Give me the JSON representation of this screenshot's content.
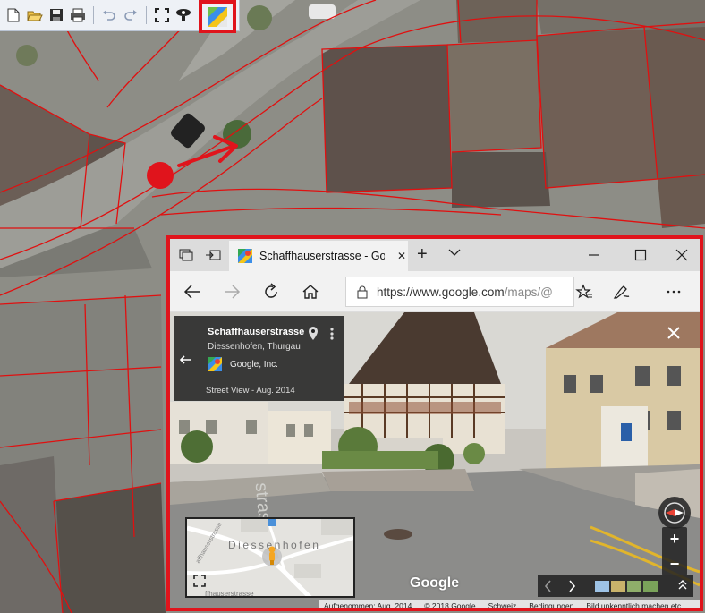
{
  "browser": {
    "tab_title": "Schaffhauserstrasse - Go",
    "url_host": "https://www.google.com",
    "url_path": "/maps/@"
  },
  "street_view": {
    "place_name": "Schaffhauserstrasse",
    "place_sub": "Diessenhofen, Thurgau",
    "owner": "Google, Inc.",
    "date": "Street View - Aug. 2014",
    "google_logo": "Google",
    "minimap_label": "Diessenhofen"
  },
  "footer": {
    "captured": "Aufgenommen: Aug. 2014",
    "copyright": "© 2018 Google",
    "country": "Schweiz",
    "terms": "Bedingungen",
    "report": "Bild unkenntlich machen etc."
  },
  "icons": {
    "toolbar": [
      "new-file-icon",
      "open-folder-icon",
      "save-icon",
      "print-icon",
      "undo-icon",
      "redo-icon",
      "fullscreen-icon",
      "streetview-eye-icon",
      "google-maps-icon"
    ],
    "browser": [
      "tab-preview-icon",
      "set-aside-tabs-icon",
      "google-maps-favicon",
      "new-tab-icon",
      "back-icon",
      "forward-icon",
      "refresh-icon",
      "home-icon",
      "lock-icon",
      "favorites-icon",
      "pen-icon",
      "more-icon"
    ]
  },
  "colors": {
    "highlight": "#e0141c",
    "parcel_lines": "#e01010",
    "panel": "#222222"
  }
}
